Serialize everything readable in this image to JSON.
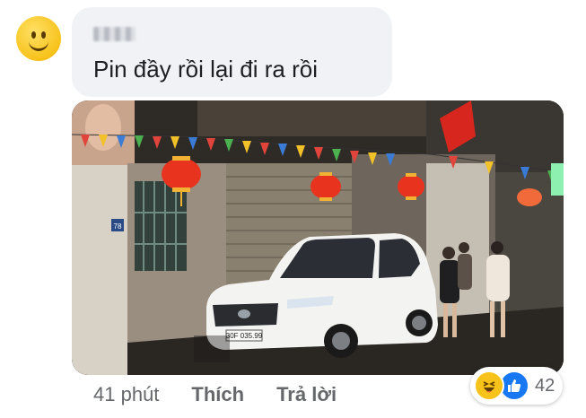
{
  "comment": {
    "author": "",
    "text": "Pin đầy rồi lại đi ra rồi"
  },
  "photo": {
    "house_number": "78",
    "plate": "30F 035.99"
  },
  "actions": {
    "time": "41 phút",
    "like": "Thích",
    "reply": "Trả lời"
  },
  "reactions": {
    "icons": [
      "haha-icon",
      "like-icon"
    ],
    "count": "42"
  },
  "colors": {
    "bubble": "#f0f2f5",
    "like_blue": "#1877f2",
    "haha_yellow": "#f7c21a",
    "meta_text": "#65676b"
  }
}
